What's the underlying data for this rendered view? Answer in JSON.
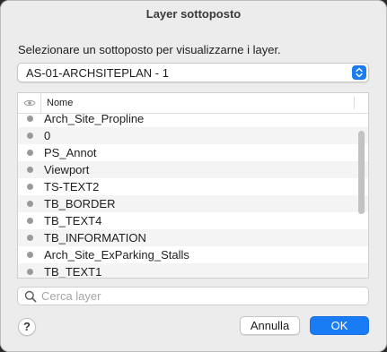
{
  "window": {
    "title": "Layer sottoposto"
  },
  "instruction": "Selezionare un sottoposto per visualizzarne i layer.",
  "underlay_select": {
    "value": "AS-01-ARCHSITEPLAN - 1"
  },
  "table": {
    "columns": [
      "Nome"
    ],
    "visibility_icon": "eye-icon",
    "rows": [
      {
        "name": "Arch_Site_Propline"
      },
      {
        "name": "0"
      },
      {
        "name": "PS_Annot"
      },
      {
        "name": "Viewport"
      },
      {
        "name": "TS-TEXT2"
      },
      {
        "name": "TB_BORDER"
      },
      {
        "name": "TB_TEXT4"
      },
      {
        "name": "TB_INFORMATION"
      },
      {
        "name": "Arch_Site_ExParking_Stalls"
      },
      {
        "name": "TB_TEXT1"
      }
    ]
  },
  "search": {
    "placeholder": "Cerca layer",
    "value": ""
  },
  "buttons": {
    "help": "?",
    "cancel": "Annulla",
    "ok": "OK"
  },
  "colors": {
    "accent": "#1a7cf5",
    "dialog_bg": "#ececec",
    "dot": "#9a9a9a"
  }
}
